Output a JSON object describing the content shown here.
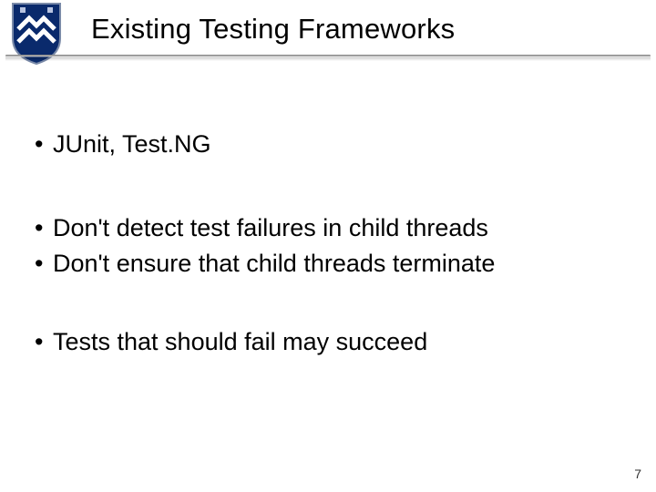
{
  "slide": {
    "title": "Existing Testing Frameworks",
    "page_number": "7",
    "logo": {
      "name": "shield-logo",
      "bg": "#0a2a6c",
      "accent": "#ffffff",
      "border": "#7a8aa8"
    }
  },
  "bullets": {
    "group1": [
      {
        "text": "JUnit, Test.NG"
      }
    ],
    "group2": [
      {
        "text": "Don't detect test failures in child threads"
      },
      {
        "text": "Don't ensure that child threads terminate"
      }
    ],
    "group3": [
      {
        "text": "Tests that should fail may succeed"
      }
    ]
  }
}
